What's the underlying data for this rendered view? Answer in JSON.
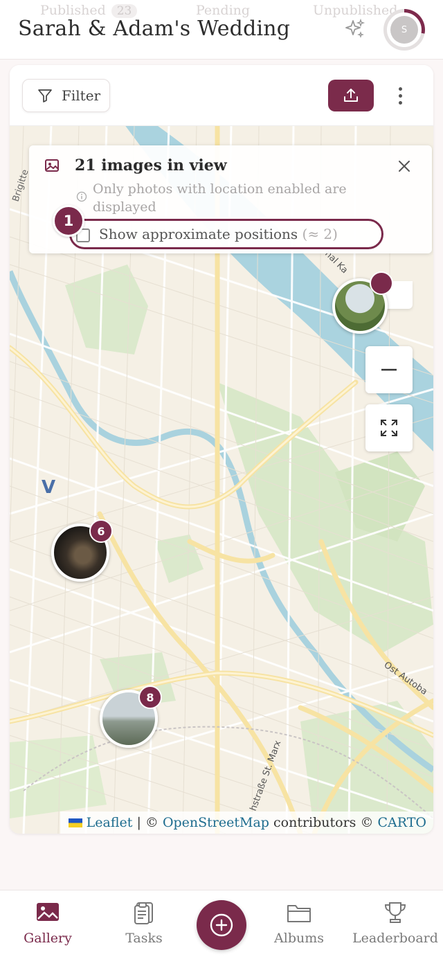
{
  "header": {
    "ghost_tabs": [
      {
        "label": "Published",
        "count": "23"
      },
      {
        "label": "Pending",
        "count": ""
      },
      {
        "label": "Unpublished",
        "count": ""
      }
    ],
    "title": "Sarah & Adam's Wedding",
    "avatar_initial": "S",
    "sparkle_icon": "sparkle-icon"
  },
  "toolbar": {
    "filter_label": "Filter",
    "upload_icon": "upload-icon",
    "more_icon": "more-vertical-icon"
  },
  "map": {
    "info": {
      "title": "21 images in view",
      "hint": "Only photos with location enabled are displayed",
      "approx_label": "Show approximate positions",
      "approx_count": "(≈ 2)",
      "approx_checked": false
    },
    "step_badge": "1",
    "clusters": [
      {
        "count": "6"
      },
      {
        "count": "8"
      },
      {
        "count": ""
      }
    ],
    "street_labels": [
      "Brigitte",
      "nal Ka",
      "hstraße St. Marx",
      "Ost Autoba",
      "V"
    ],
    "attribution": {
      "leaflet": "Leaflet",
      "separator": " | © ",
      "osm": "OpenStreetMap",
      "contributors": " contributors © ",
      "carto": "CARTO"
    }
  },
  "nav": {
    "items": [
      {
        "label": "Gallery",
        "icon": "image-icon",
        "active": true
      },
      {
        "label": "Tasks",
        "icon": "clipboard-icon",
        "active": false
      },
      {
        "label": "Albums",
        "icon": "folder-icon",
        "active": false
      },
      {
        "label": "Leaderboard",
        "icon": "trophy-icon",
        "active": false
      }
    ],
    "add_icon": "plus-circle-icon"
  },
  "colors": {
    "brand": "#7a2a4b",
    "map_water": "#aad3df",
    "map_park": "#d8e8c8",
    "map_land": "#f4efe4"
  }
}
